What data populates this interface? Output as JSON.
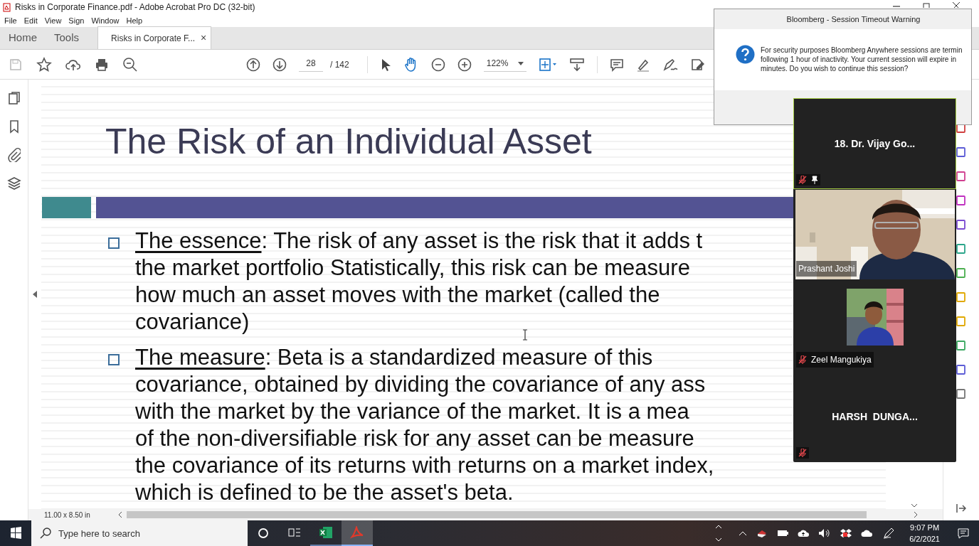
{
  "window": {
    "title": "Risks in Corporate Finance.pdf - Adobe Acrobat Pro DC (32-bit)"
  },
  "menu": [
    "File",
    "Edit",
    "View",
    "Sign",
    "Window",
    "Help"
  ],
  "tabs": [
    {
      "label": "Home",
      "selected": false
    },
    {
      "label": "Tools",
      "selected": false
    },
    {
      "label": "Risks in Corporate F...",
      "selected": true,
      "close": "×"
    }
  ],
  "toolbar": {
    "page": "28",
    "page_count": "/ 142",
    "zoom": "122%"
  },
  "slide": {
    "title": "The Risk of an Individual Asset",
    "bullets": [
      {
        "lead": "The essence",
        "lines": [
          ": The risk of any asset is the risk that it adds t",
          "the market portfolio Statistically, this risk can be measure",
          "how much an asset moves with the market (called the",
          "covariance)"
        ]
      },
      {
        "lead": "The measure",
        "lines": [
          ": Beta is a standardized measure of this",
          "covariance, obtained by dividing the covariance of any ass",
          "with the market by the variance of the market. It is a mea",
          "of the non-diversifiable risk for any asset can be measure",
          "the covariance of its returns with returns on a market index,",
          "which is defined to be the asset's beta."
        ]
      }
    ]
  },
  "status": {
    "page_size": "11.00 x 8.50 in"
  },
  "dialog": {
    "title": "Bloomberg - Session Timeout Warning",
    "lines": [
      "For security purposes Bloomberg Anywhere sessions are termin",
      "following 1 hour of inactivity. Your current session will expire in",
      "minutes. Do you wish to continue this session?"
    ]
  },
  "meeting": {
    "tiles": [
      {
        "kind": "name",
        "name": "18. Dr. Vijay Go...",
        "active": true,
        "muted": true,
        "pinned": true
      },
      {
        "kind": "video",
        "name": "Prashant Joshi",
        "active": false,
        "muted": false,
        "pinned": false
      },
      {
        "kind": "avatar",
        "name": "Zeel Mangukiya",
        "active": false,
        "muted": true,
        "pinned": false
      },
      {
        "kind": "name",
        "name": "HARSH  DUNGA...",
        "active": false,
        "muted": true,
        "pinned": false
      }
    ]
  },
  "taskbar": {
    "search_placeholder": "Type here to search",
    "apps": [
      {
        "kind": "excel",
        "selected": false
      },
      {
        "kind": "acrobat",
        "selected": true
      }
    ],
    "time": "9:07 PM",
    "date": "6/2/2021"
  }
}
